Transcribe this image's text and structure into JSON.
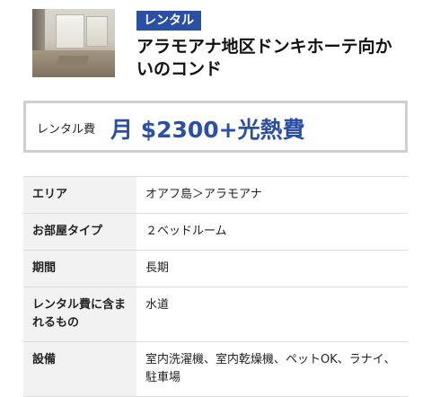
{
  "badge": "レンタル",
  "title": "アラモアナ地区ドンキホーテ向かいのコンド",
  "rent": {
    "label": "レンタル費",
    "value": "月 $2300+光熱費"
  },
  "details": [
    {
      "key": "エリア",
      "value": "オアフ島＞アラモアナ"
    },
    {
      "key": "お部屋タイプ",
      "value": "２ベッドルーム"
    },
    {
      "key": "期間",
      "value": "長期"
    },
    {
      "key": "レンタル費に含まれるもの",
      "value": "水道"
    },
    {
      "key": "設備",
      "value": "室内洗濯機、室内乾燥機、ペットOK、ラナイ、駐車場"
    }
  ],
  "colors": {
    "accent": "#2b4fa3",
    "label_bg": "#f2f2f2",
    "border": "#cfcfcf"
  }
}
